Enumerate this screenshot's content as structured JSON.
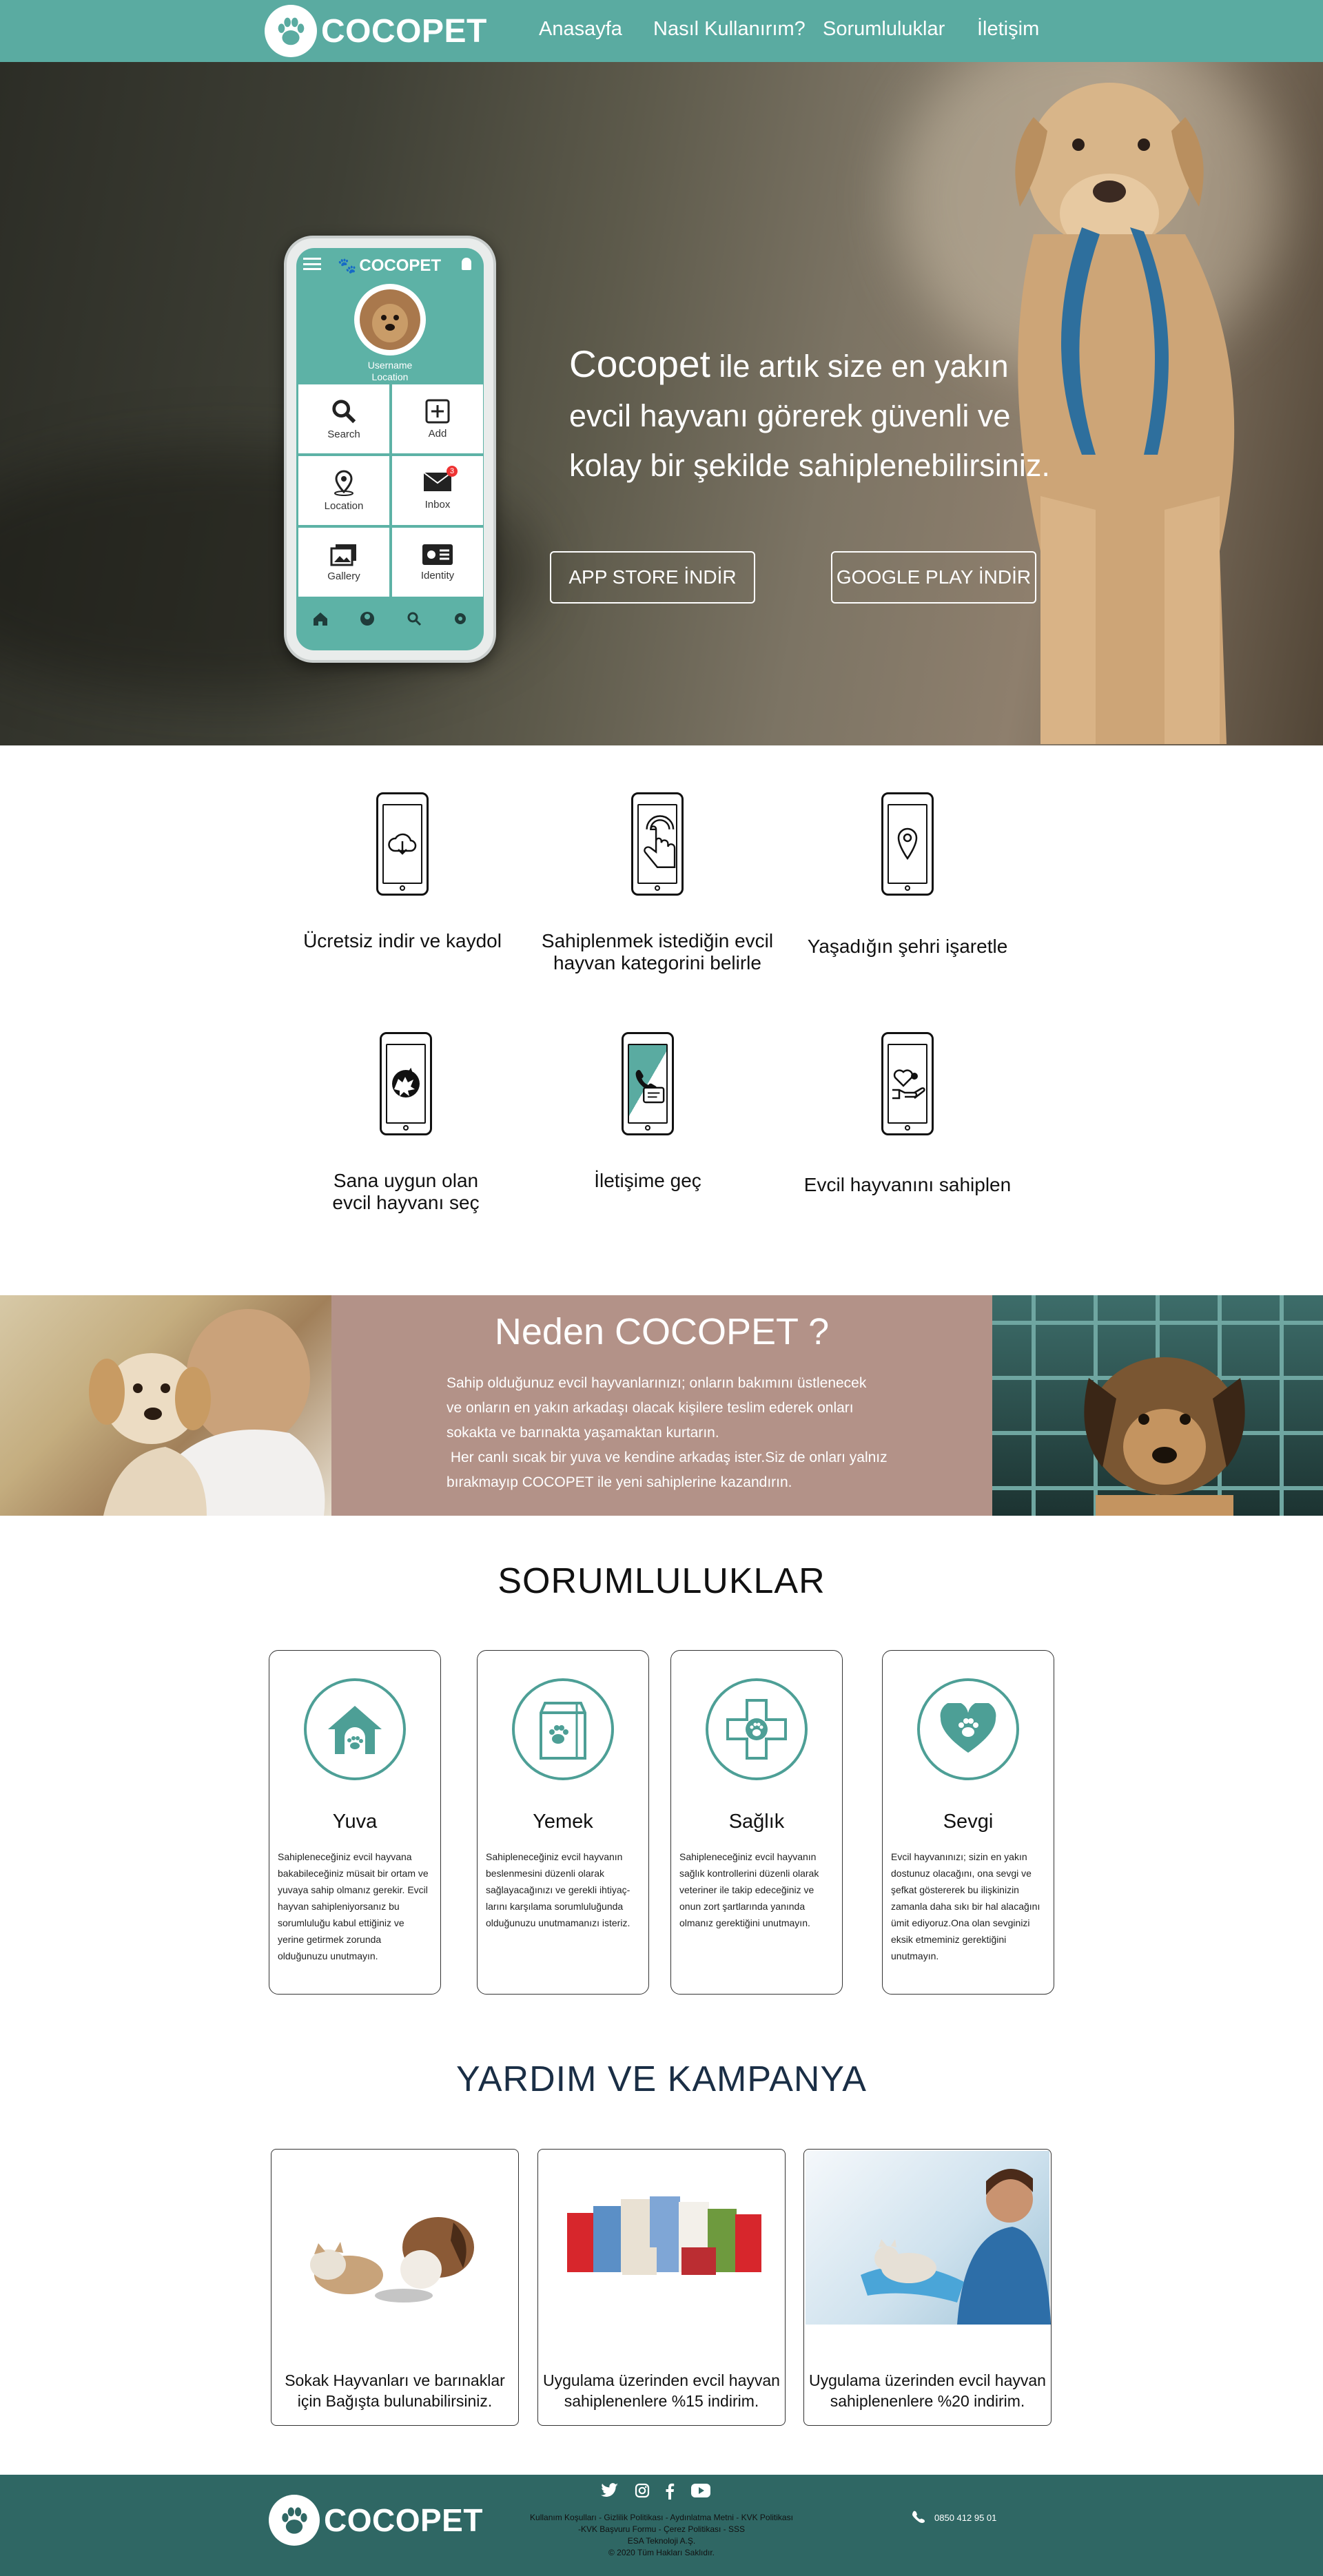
{
  "header": {
    "logo_text": "COCOPET",
    "nav": [
      "Anasayfa",
      "Nasıl Kullanırım?",
      "Sorumluluklar",
      "İletişim"
    ]
  },
  "hero": {
    "phone": {
      "app_title": "COCOPET",
      "username": "Username",
      "location": "Location",
      "tiles": [
        "Search",
        "Add",
        "Location",
        "Inbox",
        "Gallery",
        "Identity"
      ],
      "inbox_badge": "3"
    },
    "headline_brand": "Cocopet",
    "headline_rest_1": " ile artık size en yakın",
    "headline_line_2": "evcil hayvanı görerek güvenli ve",
    "headline_line_3": "kolay bir şekilde  sahiplenebilirsiniz.",
    "btn_appstore": "APP STORE İNDİR",
    "btn_googleplay": "GOOGLE PLAY İNDİR"
  },
  "steps": [
    {
      "icon": "cloud-download-icon",
      "label": "Ücretsiz indir ve kaydol"
    },
    {
      "icon": "touch-icon",
      "label": "Sahiplenmek istediğin evcil hayvan kategorini belirle"
    },
    {
      "icon": "location-pin-icon",
      "label": "Yaşadığın şehri işaretle"
    },
    {
      "icon": "pet-select-icon",
      "label": "Sana uygun olan evcil hayvanı seç"
    },
    {
      "icon": "contact-icon",
      "label": "İletişime geç"
    },
    {
      "icon": "adopt-icon",
      "label": "Evcil hayvanını sahiplen"
    }
  ],
  "why": {
    "title": "Neden COCOPET ?",
    "body_lines": [
      "Sahip olduğunuz evcil hayvanlarınızı; onların bakımını üstlenecek",
      "ve onların en yakın arkadaşı olacak kişilere teslim ederek onları",
      "sokakta ve barınakta yaşamaktan kurtarın.",
      " Her canlı sıcak bir yuva ve kendine arkadaş ister.Siz de onları yalnız",
      "bırakmayıp COCOPET ile yeni sahiplerine kazandırın."
    ]
  },
  "responsibilities": {
    "title": "SORUMLULUKLAR",
    "cards": [
      {
        "icon": "dog-house-icon",
        "title": "Yuva",
        "text": "Sahipleneceğiniz  evcil hayvana bakabileceğiniz müsait bir ortam ve yuvaya sahip olmanız gerekir. Evcil hayvan sahipleniyorsanız bu sorumluluğu kabul ettiğiniz ve yerine getirmek zorunda olduğunuzu unutmayın."
      },
      {
        "icon": "pet-food-icon",
        "title": "Yemek",
        "text": "Sahipleneceğiniz  evcil hayvanın beslenmesini düzenli olarak sağlayacağınızı ve gerekli ihtiyaç-larını karşılama sorumluluğunda olduğunuzu unutmamanızı isteriz."
      },
      {
        "icon": "health-cross-icon",
        "title": "Sağlık",
        "text": "Sahipleneceğiniz  evcil hayvanın sağlık kontrollerini düzenli olarak veteriner ile takip edeceğiniz ve onun zort şartlarında yanında olmanız gerektiğini unutmayın."
      },
      {
        "icon": "heart-paw-icon",
        "title": "Sevgi",
        "text": "Evcil hayvanınızı; sizin en yakın dostunuz olacağını, ona sevgi ve şefkat göstererek  bu ilişkinizin zamanla daha sıkı bir hal alacağını ümit ediyoruz.Ona olan sevginizi eksik etmeminiz gerektiğini unutmayın."
      }
    ]
  },
  "help": {
    "title": "YARDIM VE KAMPANYA",
    "cards": [
      {
        "caption_1": "Sokak Hayvanları ve barınaklar",
        "caption_2": "için Bağışta bulunabilirsiniz."
      },
      {
        "caption_1": "Uygulama üzerinden evcil hayvan",
        "caption_2": "sahiplenenlere %15 indirim."
      },
      {
        "caption_1": "Uygulama üzerinden evcil hayvan",
        "caption_2": "sahiplenenlere %20 indirim."
      }
    ]
  },
  "footer": {
    "logo_text": "COCOPET",
    "links_1": "Kullanım Koşulları - Gizlilik Politikası - Aydınlatma Metni - KVK Politikası",
    "links_2": "-KVK Başvuru Formu - Çerez Politikası - SSS",
    "company": "ESA Teknoloji A.Ş.",
    "copyright": "© 2020  Tüm Hakları Saklıdır.",
    "phone": "0850 412 95 01",
    "social": [
      "twitter-icon",
      "instagram-icon",
      "facebook-icon",
      "youtube-icon"
    ]
  },
  "colors": {
    "teal": "#5aaba1",
    "dark_teal": "#2f6764",
    "mauve": "#b39288",
    "navy": "#1a2e45"
  }
}
